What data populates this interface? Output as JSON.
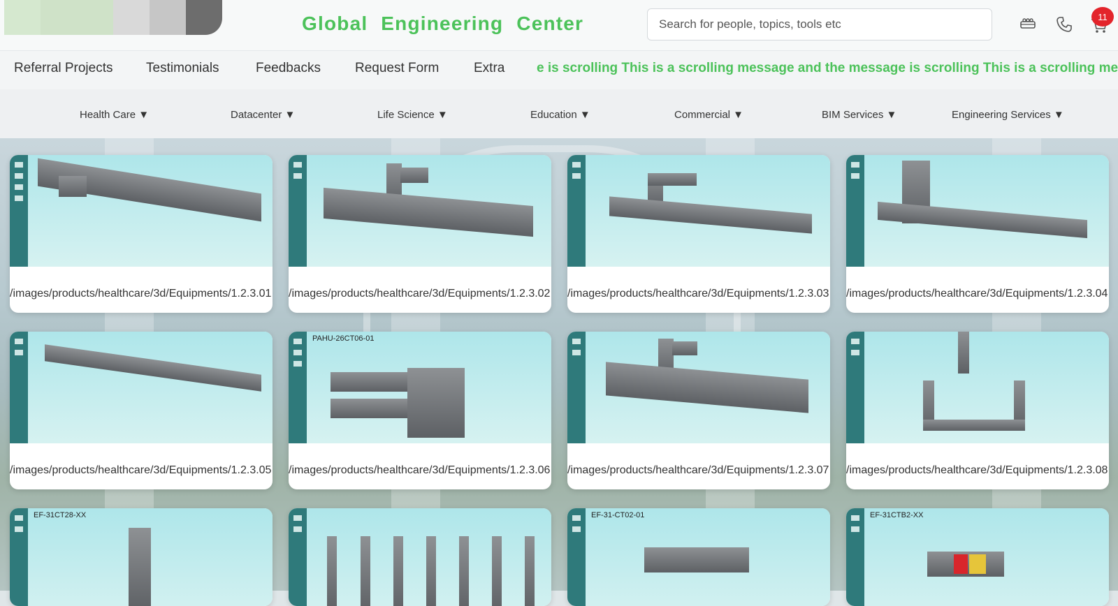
{
  "header": {
    "site_title": "Global Engineering Center",
    "search_placeholder": "Search for people, topics, tools etc",
    "cart_badge": "11",
    "icons": [
      "meeting-icon",
      "phone-icon",
      "cart-icon"
    ]
  },
  "nav_primary": {
    "items": [
      "Referral Projects",
      "Testimonials",
      "Feedbacks",
      "Request Form",
      "Extra"
    ],
    "marquee": "e is scrolling This is a scrolling message and the message is scrolling This is a scrolling message and t"
  },
  "nav_secondary": {
    "items": [
      "Health Care ▼",
      "Datacenter ▼",
      "Life Science ▼",
      "Education ▼",
      "Commercial ▼",
      "BIM Services ▼",
      "Engineering Services ▼"
    ]
  },
  "cards": [
    {
      "caption": "/images/products/healthcare/3d/Equipments/1.2.3.01",
      "label": ""
    },
    {
      "caption": "/images/products/healthcare/3d/Equipments/1.2.3.02",
      "label": ""
    },
    {
      "caption": "/images/products/healthcare/3d/Equipments/1.2.3.03",
      "label": ""
    },
    {
      "caption": "/images/products/healthcare/3d/Equipments/1.2.3.04",
      "label": ""
    },
    {
      "caption": "/images/products/healthcare/3d/Equipments/1.2.3.05",
      "label": ""
    },
    {
      "caption": "/images/products/healthcare/3d/Equipments/1.2.3.06",
      "label": "PAHU-26CT06-01"
    },
    {
      "caption": "/images/products/healthcare/3d/Equipments/1.2.3.07",
      "label": ""
    },
    {
      "caption": "/images/products/healthcare/3d/Equipments/1.2.3.08",
      "label": ""
    },
    {
      "caption": "",
      "label": "EF-31CT28-XX"
    },
    {
      "caption": "",
      "label": ""
    },
    {
      "caption": "",
      "label": "EF-31-CT02-01"
    },
    {
      "caption": "",
      "label": "EF-31CTB2-XX"
    }
  ],
  "colors": {
    "brand_green": "#4cc25a",
    "badge_red": "#e3242b",
    "rail_teal": "#2f7a7b"
  }
}
